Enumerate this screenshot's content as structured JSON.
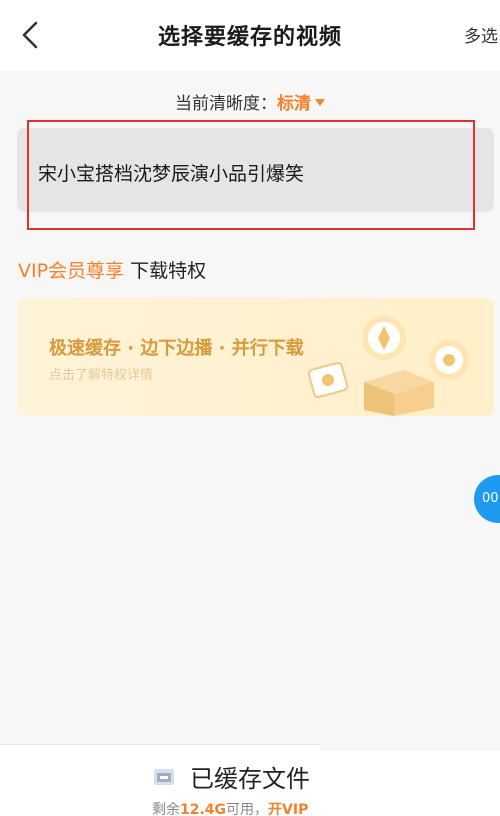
{
  "header": {
    "back_icon": "chevron-left-icon",
    "title": "选择要缓存的视频",
    "multi_select_label": "多选"
  },
  "quality": {
    "label": "当前清晰度：",
    "value": "标清",
    "caret_icon": "caret-down-icon"
  },
  "video": {
    "title": "宋小宝搭档沈梦辰演小品引爆笑"
  },
  "vip": {
    "label": "VIP会员尊享",
    "sub": "下载特权",
    "banner_title": "极速缓存 · 边下边播 · 并行下载",
    "banner_sub": "点击了解特权详情"
  },
  "float_bubble": {
    "text": "00"
  },
  "bottom": {
    "cached_label": "已缓存文件",
    "storage_prefix": "剩余",
    "storage_value": "12.4G",
    "storage_suffix": "可用，",
    "storage_vip": "开VIP"
  },
  "colors": {
    "accent": "#f5822a",
    "highlight": "#e0332d",
    "bubble": "#1e9bf0",
    "banner_text": "#d89a3a"
  }
}
